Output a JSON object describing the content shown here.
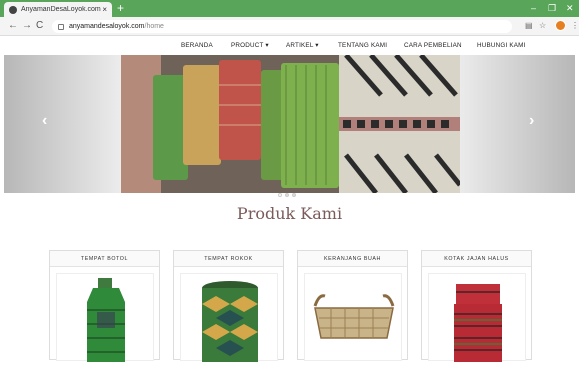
{
  "browser": {
    "tab_title": "AnyamanDesaLoyok.com",
    "tab_close": "×",
    "new_tab": "+",
    "url_host": "anyamandesaloyok.com",
    "url_path": "/home",
    "window_min": "–",
    "window_max": "❐",
    "window_close": "✕"
  },
  "nav": {
    "items": [
      "BERANDA",
      "PRODUCT ▾",
      "ARTIKEL ▾",
      "TENTANG KAMI",
      "CARA PEMBELIAN",
      "HUBUNGI KAMI"
    ]
  },
  "carousel": {
    "prev": "‹",
    "next": "›",
    "slide_count": 3,
    "active_index": 0
  },
  "section_title": "Produk Kami",
  "products": [
    "TEMPAT BOTOL",
    "TEMPAT ROKOK",
    "KERANJANG BUAH",
    "KOTAK JAJAN HALUS"
  ],
  "icons": {
    "back": "arrow-left-icon",
    "forward": "arrow-right-icon",
    "reload": "reload-icon",
    "lock": "lock-icon",
    "translate": "translate-icon",
    "bookmark": "star-icon",
    "menu": "more-vert-icon"
  },
  "colors": {
    "tab_bar": "#59a559",
    "title": "#7a5a5a"
  }
}
